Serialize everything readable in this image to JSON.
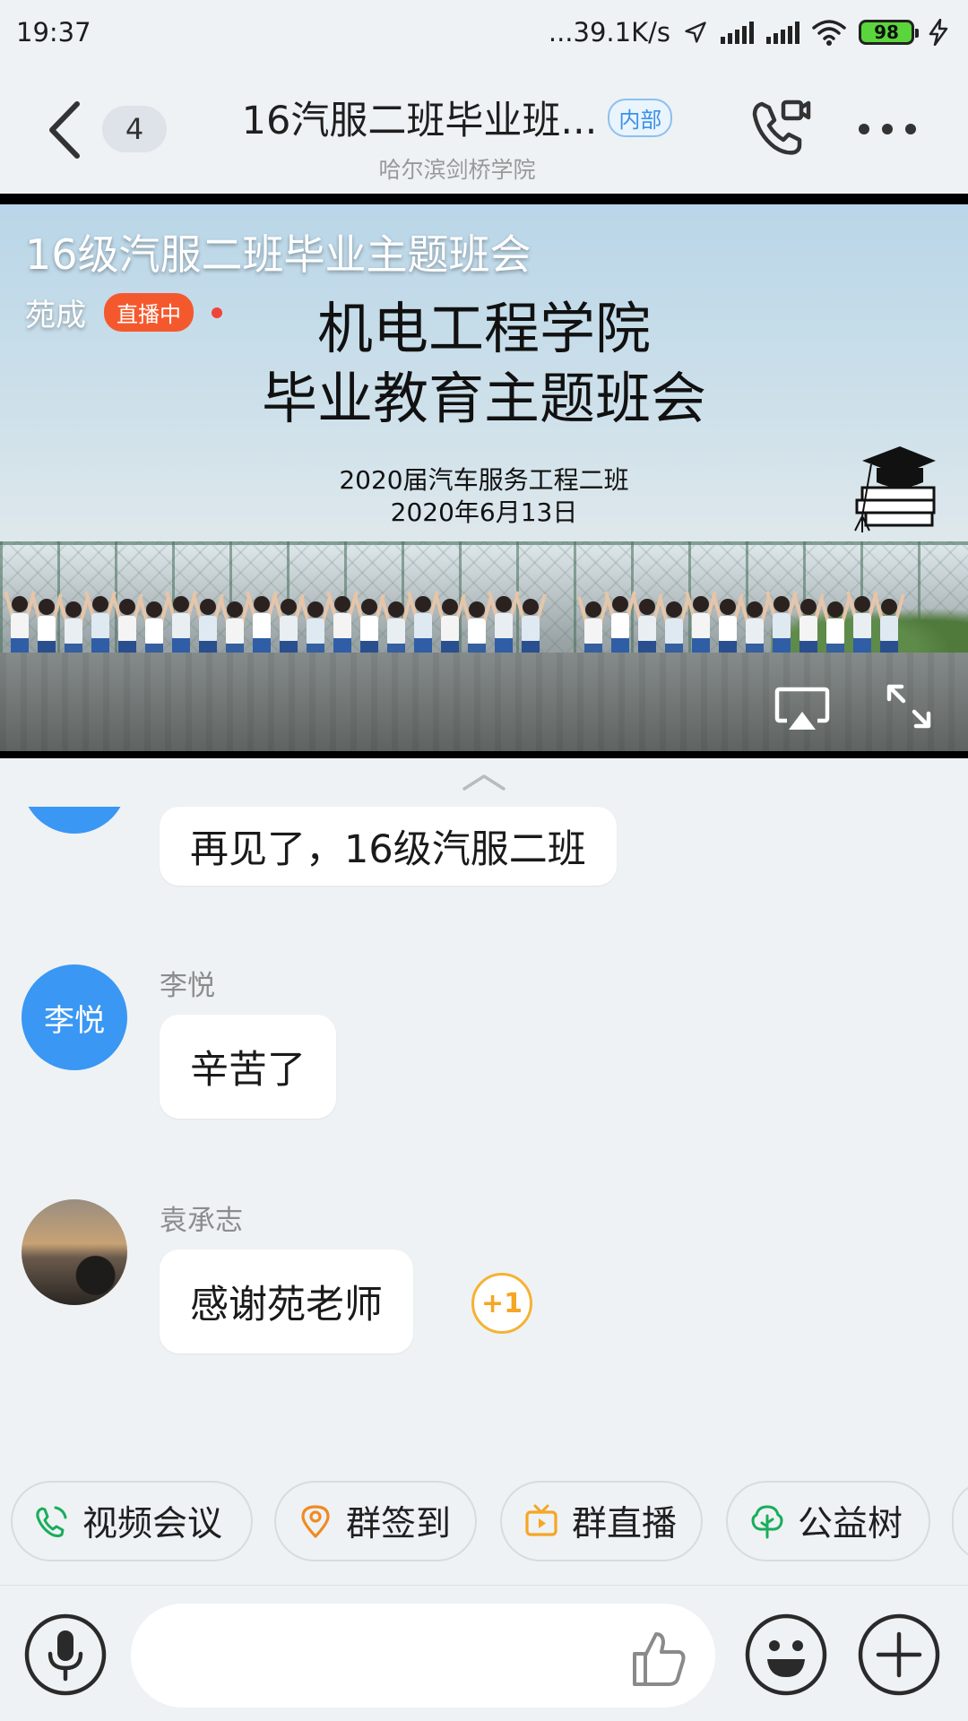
{
  "status_bar": {
    "time": "19:37",
    "network_speed": "...39.1K/s",
    "battery_level": "98",
    "icons": [
      "location-arrow-icon",
      "signal-icon",
      "signal-icon",
      "wifi-icon",
      "battery-icon",
      "charging-icon"
    ]
  },
  "header": {
    "unread_count": "4",
    "title": "16汽服二班毕业班...",
    "tag": "内部",
    "subtitle": "哈尔滨剑桥学院",
    "icons": [
      "back-icon",
      "video-call-icon",
      "more-icon"
    ]
  },
  "live": {
    "title": "16级汽服二班毕业主题班会",
    "host": "苑成",
    "status": "直播中",
    "slide_heading_line1": "机电工程学院",
    "slide_heading_line2": "毕业教育主题班会",
    "slide_sub_line1": "2020届汽车服务工程二班",
    "slide_sub_line2": "2020年6月13日",
    "icons": [
      "graduation-cap-icon",
      "airplay-icon",
      "fullscreen-icon",
      "collapse-icon"
    ]
  },
  "messages": [
    {
      "sender": "",
      "avatar_text": "",
      "text": "再见了，16级汽服二班"
    },
    {
      "sender": "李悦",
      "avatar_text": "李悦",
      "text": "辛苦了"
    },
    {
      "sender": "袁承志",
      "avatar_text": "",
      "text": "感谢苑老师",
      "reaction": "+1"
    }
  ],
  "quick_actions": [
    {
      "label": "视频会议",
      "icon": "video-meeting-icon",
      "color": "#1aad5b"
    },
    {
      "label": "群签到",
      "icon": "location-pin-icon",
      "color": "#f08a24"
    },
    {
      "label": "群直播",
      "icon": "tv-live-icon",
      "color": "#f5a623"
    },
    {
      "label": "公益树",
      "icon": "tree-icon",
      "color": "#1aad5b"
    }
  ],
  "input": {
    "placeholder": "",
    "icons": [
      "microphone-icon",
      "thumbs-up-icon",
      "emoji-icon",
      "plus-icon"
    ]
  },
  "colors": {
    "background": "#eef2f4",
    "avatar_blue": "#3a97f3",
    "live_badge": "#f4592e",
    "tag_blue": "#3a92e8"
  }
}
